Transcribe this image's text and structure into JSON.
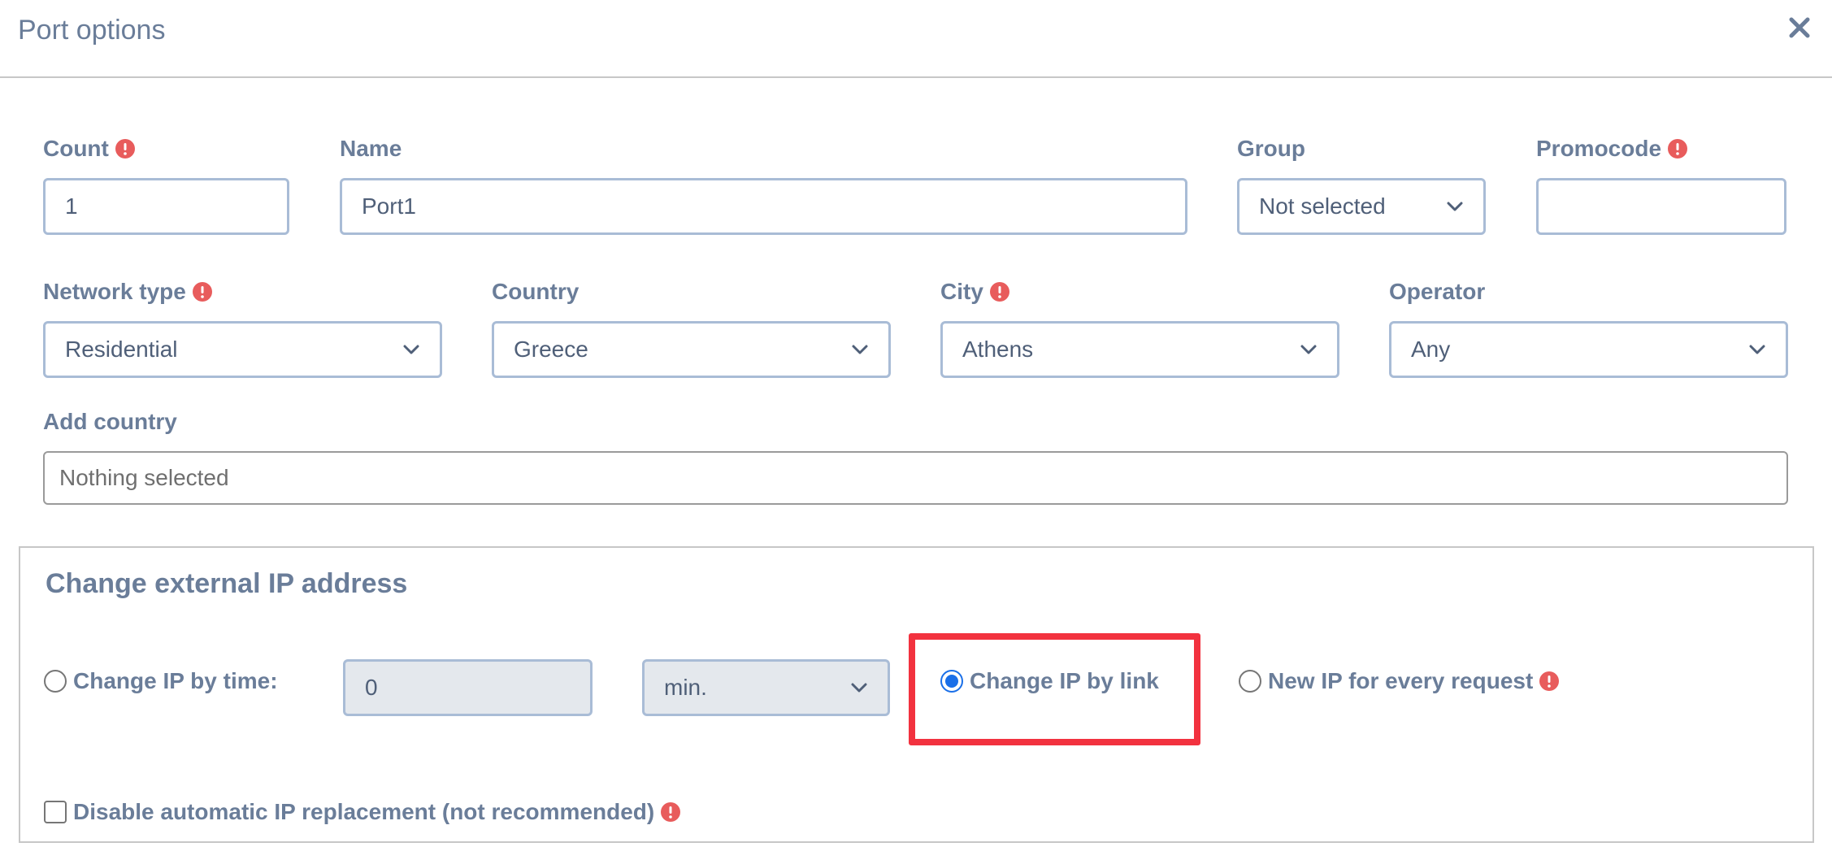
{
  "dialog": {
    "title": "Port options",
    "close_icon": "close-icon"
  },
  "fields": {
    "count": {
      "label": "Count",
      "value": "1",
      "warning": true
    },
    "name": {
      "label": "Name",
      "value": "Port1"
    },
    "group": {
      "label": "Group",
      "selected": "Not selected"
    },
    "promocode": {
      "label": "Promocode",
      "value": "",
      "warning": true
    },
    "network_type": {
      "label": "Network type",
      "selected": "Residential",
      "warning": true
    },
    "country": {
      "label": "Country",
      "selected": "Greece"
    },
    "city": {
      "label": "City",
      "selected": "Athens",
      "warning": true
    },
    "operator": {
      "label": "Operator",
      "selected": "Any"
    },
    "add_country": {
      "label": "Add country",
      "placeholder": "Nothing selected"
    }
  },
  "ip_change": {
    "legend": "Change external IP address",
    "by_time": {
      "label": "Change IP by time:",
      "checked": false,
      "value": "0",
      "unit": "min."
    },
    "by_link": {
      "label": "Change IP by link",
      "checked": true
    },
    "every_request": {
      "label": "New IP for every request",
      "checked": false,
      "warning": true
    },
    "disable_auto": {
      "label": "Disable automatic IP replacement (not recommended)",
      "checked": false,
      "warning": true
    }
  },
  "colors": {
    "text": "#6a7d99",
    "input_border": "#a9bcd6",
    "warning": "#e85c5c",
    "radio_checked": "#1a6fe8",
    "highlight": "#f2323f"
  }
}
